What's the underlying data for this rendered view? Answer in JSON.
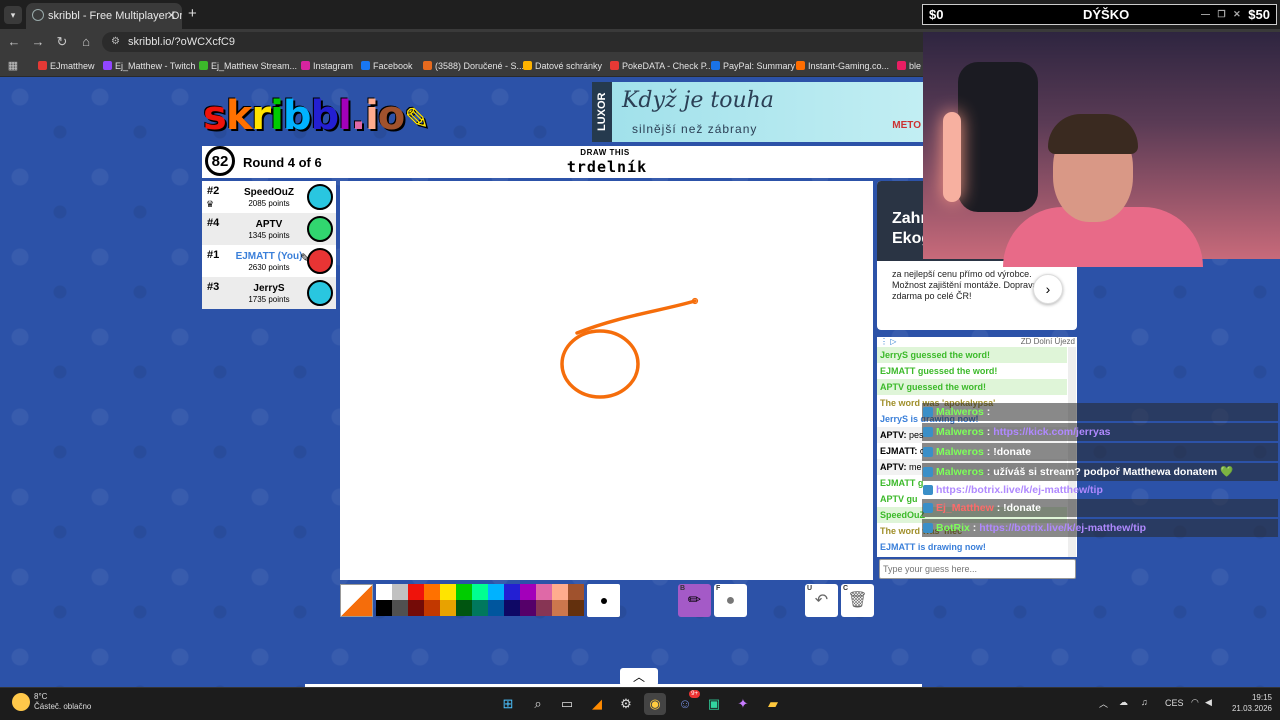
{
  "browser": {
    "tab_title": "skribbl - Free Multiplayer Draw",
    "url": "skribbl.io/?oWCXcfC9",
    "bookmarks": [
      {
        "label": "EJmatthew",
        "color": "#e53935"
      },
      {
        "label": "Ej_Matthew - Twitch",
        "color": "#9146ff"
      },
      {
        "label": "Ej_Matthew Stream...",
        "color": "#3cba2a"
      },
      {
        "label": "Instagram",
        "color": "#d6249f"
      },
      {
        "label": "Facebook",
        "color": "#1877f2"
      },
      {
        "label": "(3588) Doručené - S...",
        "color": "#e66a1e"
      },
      {
        "label": "Datové schránky",
        "color": "#ffb300"
      },
      {
        "label": "PokeDATA - Check P...",
        "color": "#e53935"
      },
      {
        "label": "PayPal: Summary",
        "color": "#1a73e8"
      },
      {
        "label": "Instant-Gaming.co...",
        "color": "#ff6d00"
      },
      {
        "label": "ble",
        "color": "#e91e63"
      }
    ]
  },
  "ad_banner": {
    "brand": "LUXOR",
    "line1": "Když je touha",
    "line2": "silnější než zábrany",
    "corner": "METO"
  },
  "game": {
    "logo": "skribbl.io",
    "timer": "82",
    "round": "Round 4 of 6",
    "draw_this": "DRAW THIS",
    "word": "trdelník"
  },
  "players": [
    {
      "rank": "#2",
      "name": "SpeedOuZ",
      "points": "2085 points",
      "avatar_color": "#29c6e0",
      "highlight": false
    },
    {
      "rank": "#4",
      "name": "APTV",
      "points": "1345 points",
      "avatar_color": "#31d66f",
      "highlight": false
    },
    {
      "rank": "#1",
      "name": "EJMATT (You)",
      "points": "2630 points",
      "avatar_color": "#e83434",
      "highlight": true
    },
    {
      "rank": "#3",
      "name": "JerryS",
      "points": "1735 points",
      "avatar_color": "#29c6e0",
      "highlight": false
    }
  ],
  "side_ad": {
    "title": "Zahr\nEkog",
    "text": "za nejlepší cenu přímo od výrobce. Možnost zajištění montáže. Doprava zdarma po celé ČR!",
    "source": "ZD Dolní Újezd"
  },
  "chat": [
    {
      "text": "JerryS guessed the word!",
      "style": "green"
    },
    {
      "text": "EJMATT guessed the word!",
      "style": "greenw"
    },
    {
      "text": "APTV guessed the word!",
      "style": "green"
    },
    {
      "text": "The word was 'apokalypsa'",
      "style": "ol"
    },
    {
      "text": "JerryS is drawing now!",
      "style": "blue"
    },
    {
      "name": "APTV:",
      "text": "pes",
      "style": "plain"
    },
    {
      "name": "EJMATT:",
      "text": "c",
      "style": "plain"
    },
    {
      "name": "APTV:",
      "text": "me",
      "style": "plain"
    },
    {
      "text": "EJMATT g",
      "style": "greenw"
    },
    {
      "text": "APTV gu",
      "style": "greenw"
    },
    {
      "text": "SpeedOuZ",
      "style": "green"
    },
    {
      "text": "The word was 'mec",
      "style": "ol"
    },
    {
      "text": "EJMATT is drawing now!",
      "style": "blue"
    }
  ],
  "guess_placeholder": "Type your guess here...",
  "palette": {
    "row1": [
      "#ffffff",
      "#c1c1c1",
      "#ef130b",
      "#ff7100",
      "#ffe400",
      "#00cc00",
      "#00ff91",
      "#00b2ff",
      "#231fd3",
      "#a300ba",
      "#df69a7",
      "#ffac8e",
      "#a0522d"
    ],
    "row2": [
      "#000000",
      "#505050",
      "#740b07",
      "#c23800",
      "#e8a200",
      "#005510",
      "#00785d",
      "#00569e",
      "#0e0865",
      "#550069",
      "#873554",
      "#cc774d",
      "#63300d"
    ]
  },
  "current_color": "#f56d0b",
  "tools": {
    "brush_key": "B",
    "fill_key": "F",
    "undo_key": "U",
    "clear_key": "C"
  },
  "stream": {
    "left": "$0",
    "center": "DÝŠKO",
    "right": "$50"
  },
  "stream_chat": [
    {
      "user": "Malweros",
      "sep": ":",
      "msg": "",
      "link": "",
      "user_color": "u"
    },
    {
      "user": "Malweros",
      "sep": ":",
      "msg": "",
      "link": "https://kick.com/jerryas",
      "user_color": "u"
    },
    {
      "user": "Malweros",
      "sep": ":",
      "msg": "!donate",
      "link": "",
      "user_color": "u"
    },
    {
      "user": "Malweros",
      "sep": ":",
      "msg": "užíváš si stream? podpoř Matthewa donatem 💚",
      "link": "",
      "user_color": "u"
    },
    {
      "user": "",
      "sep": "",
      "msg": "",
      "link": "https://botrix.live/k/ej-matthew/tip",
      "user_color": "u"
    },
    {
      "user": "Ej_Matthew",
      "sep": ":",
      "msg": "!donate",
      "link": "",
      "user_color": "u2"
    },
    {
      "user": "BotRix",
      "sep": ":",
      "msg": "",
      "link": "https://botrix.live/k/ej-matthew/tip",
      "user_color": "u"
    }
  ],
  "taskbar": {
    "temp": "8°C",
    "weather": "Částeč. oblačno",
    "lang": "CES",
    "time": "19:15",
    "date": "21.03.2026",
    "badge": "9+"
  }
}
